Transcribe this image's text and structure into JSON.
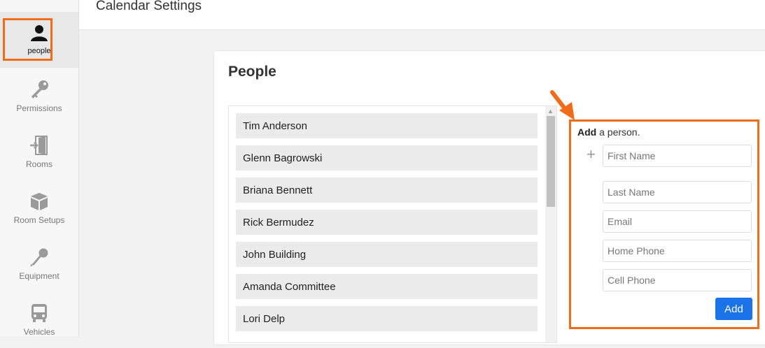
{
  "header": {
    "title": "Calendar Settings"
  },
  "sidebar": {
    "items": [
      {
        "label": "people",
        "icon": "person-icon",
        "active": true
      },
      {
        "label": "Permissions",
        "icon": "key-icon"
      },
      {
        "label": "Rooms",
        "icon": "door-icon"
      },
      {
        "label": "Room Setups",
        "icon": "box-icon"
      },
      {
        "label": "Equipment",
        "icon": "microphone-icon"
      },
      {
        "label": "Vehicles",
        "icon": "bus-icon"
      }
    ]
  },
  "card": {
    "title": "People",
    "people": [
      "Tim Anderson",
      "Glenn Bagrowski",
      "Briana Bennett",
      "Rick Bermudez",
      "John Building",
      "Amanda Committee",
      "Lori Delp"
    ]
  },
  "add_panel": {
    "heading_bold": "Add",
    "heading_rest": " a person.",
    "first_name_placeholder": "First Name",
    "last_name_placeholder": "Last Name",
    "email_placeholder": "Email",
    "home_phone_placeholder": "Home Phone",
    "cell_phone_placeholder": "Cell Phone",
    "add_button": "Add"
  },
  "colors": {
    "highlight": "#f06c1b",
    "primary_button": "#1a73e8"
  }
}
